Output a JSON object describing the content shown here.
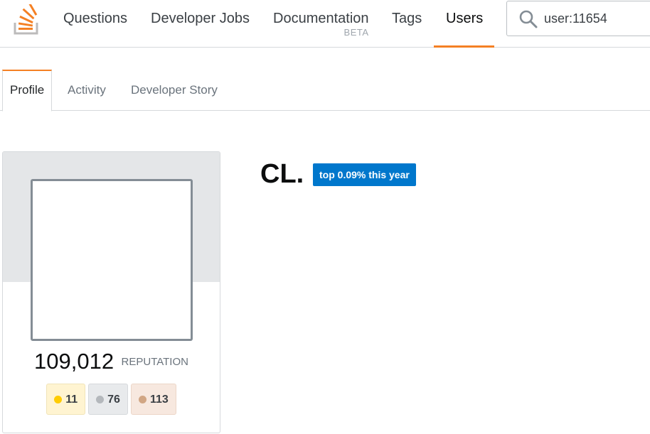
{
  "nav": {
    "items": [
      {
        "label": "Questions"
      },
      {
        "label": "Developer Jobs"
      },
      {
        "label": "Documentation",
        "badge": "BETA"
      },
      {
        "label": "Tags"
      },
      {
        "label": "Users"
      }
    ],
    "active": "Users"
  },
  "search": {
    "value": "user:11654"
  },
  "subtabs": {
    "items": [
      {
        "label": "Profile"
      },
      {
        "label": "Activity"
      },
      {
        "label": "Developer Story"
      }
    ],
    "active": "Profile"
  },
  "profile": {
    "reputation": "109,012",
    "reputation_label": "REPUTATION",
    "badges": {
      "gold": "11",
      "silver": "76",
      "bronze": "113"
    }
  },
  "user": {
    "name": "CL.",
    "rank": "top 0.09% this year"
  },
  "colors": {
    "accent": "#f48024",
    "rank_badge": "#0077cc",
    "gold": "#ffcc01",
    "silver": "#b4b8bc",
    "bronze": "#d1a684"
  },
  "icons": {
    "logo": "stackoverflow-logo",
    "search": "search-icon"
  }
}
